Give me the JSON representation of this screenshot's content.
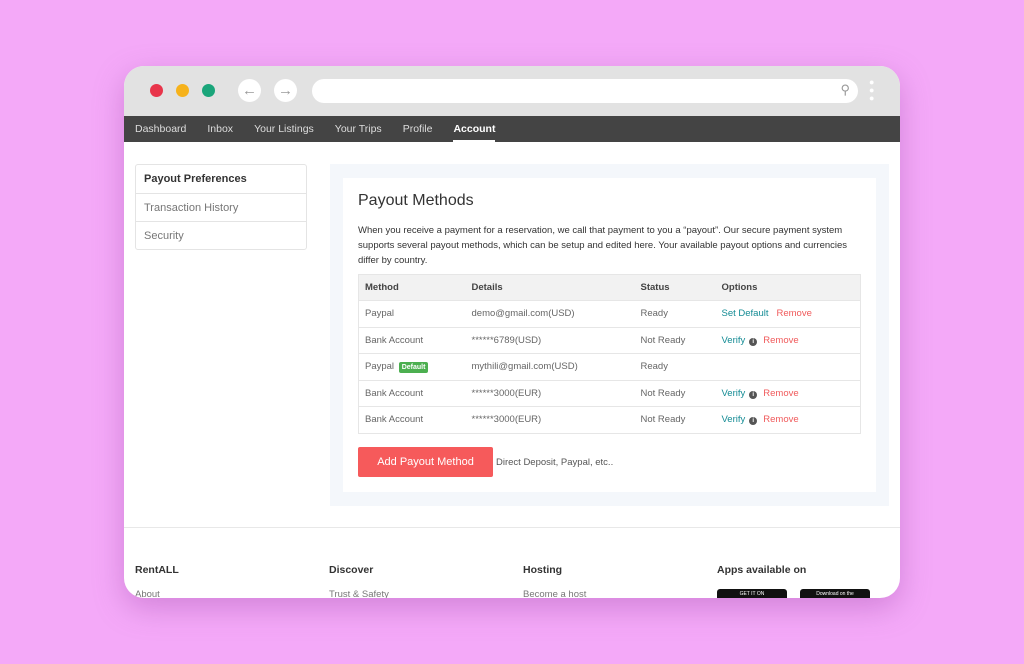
{
  "nav": [
    "Dashboard",
    "Inbox",
    "Your Listings",
    "Your Trips",
    "Profile",
    "Account"
  ],
  "sidebar": [
    "Payout Preferences",
    "Transaction History",
    "Security"
  ],
  "main": {
    "title": "Payout Methods",
    "description": "When you receive a payment for a reservation, we call that payment to you a “payout”. Our secure payment system supports several payout methods, which can be setup and edited here. Your available payout options and currencies differ by country.",
    "headers": [
      "Method",
      "Details",
      "Status",
      "Options"
    ],
    "rows": [
      {
        "method": "Paypal",
        "details": "demo@gmail.com(USD)",
        "status": "Ready",
        "opt1": "Set Default",
        "opt2": "Remove"
      },
      {
        "method": "Bank Account",
        "details": "******6789(USD)",
        "status": "Not Ready",
        "opt1": "Verify",
        "opt2": "Remove"
      },
      {
        "method": "Paypal",
        "badge": "Default",
        "details": "mythili@gmail.com(USD)",
        "status": "Ready"
      },
      {
        "method": "Bank Account",
        "details": "******3000(EUR)",
        "status": "Not Ready",
        "opt1": "Verify",
        "opt2": "Remove"
      },
      {
        "method": "Bank Account",
        "details": "******3000(EUR)",
        "status": "Not Ready",
        "opt1": "Verify",
        "opt2": "Remove"
      }
    ],
    "add_button": "Add Payout Method",
    "add_hint": "Direct Deposit, Paypal, etc.."
  },
  "footer": [
    {
      "h": "RentALL",
      "l": "About"
    },
    {
      "h": "Discover",
      "l": "Trust & Safety"
    },
    {
      "h": "Hosting",
      "l": "Become a host"
    },
    {
      "h": "Apps available on",
      "l": ""
    }
  ],
  "stores": [
    "GET IT ON",
    "Download on the"
  ]
}
